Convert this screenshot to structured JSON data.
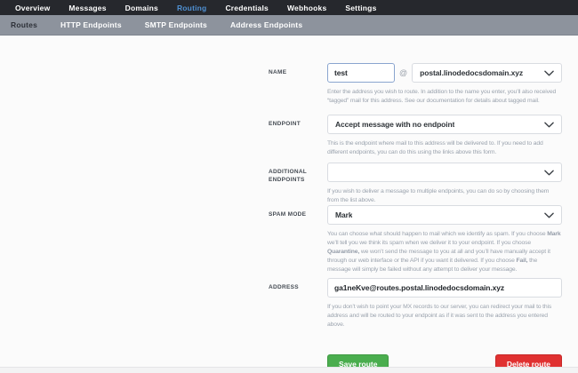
{
  "nav": {
    "items": [
      {
        "label": "Overview",
        "active": false
      },
      {
        "label": "Messages",
        "active": false
      },
      {
        "label": "Domains",
        "active": false
      },
      {
        "label": "Routing",
        "active": true
      },
      {
        "label": "Credentials",
        "active": false
      },
      {
        "label": "Webhooks",
        "active": false
      },
      {
        "label": "Settings",
        "active": false
      }
    ]
  },
  "subnav": {
    "items": [
      {
        "label": "Routes",
        "active": true
      },
      {
        "label": "HTTP Endpoints",
        "active": false
      },
      {
        "label": "SMTP Endpoints",
        "active": false
      },
      {
        "label": "Address Endpoints",
        "active": false
      }
    ]
  },
  "form": {
    "name": {
      "label": "NAME",
      "value": "test",
      "at_symbol": "@",
      "domain": "postal.linodedocsdomain.xyz",
      "help": "Enter the address you wish to route. In addition to the name you enter, you’ll also received “tagged” mail for this address. See our documentation for details about tagged mail."
    },
    "endpoint": {
      "label": "ENDPOINT",
      "value": "Accept message with no endpoint",
      "help": "This is the endpoint where mail to this address will be delivered to. If you need to add different endpoints, you can do this using the links above this form."
    },
    "additional_endpoints": {
      "label": "ADDITIONAL ENDPOINTS",
      "value": "",
      "help": "If you wish to deliver a message to multiple endpoints, you can do so by choosing them from the list above."
    },
    "spam_mode": {
      "label": "SPAM MODE",
      "value": "Mark",
      "help_segments": [
        "You can choose what should happen to mail which we identify as spam. If you choose ",
        "Mark",
        " we’ll tell you we think its spam when we deliver it to your endpoint. If you choose ",
        "Quarantine,",
        " we won’t send the message to you at all and you’ll have manually accept it through our web interface or the API if you want it delivered. If you choose ",
        "Fail,",
        " the message will simply be failed without any attempt to deliver your message."
      ]
    },
    "address": {
      "label": "ADDRESS",
      "value": "ga1neKve@routes.postal.linodedocsdomain.xyz",
      "help": "If you don’t wish to point your MX records to our server, you can redirect your mail to this address and will be routed to your endpoint as if it was sent to the address you entered above."
    },
    "buttons": {
      "save": "Save route",
      "delete": "Delete route"
    }
  },
  "colors": {
    "nav_bg": "#26282d",
    "nav_active_blue": "#4f90d2",
    "subnav_bg": "#8d939d",
    "subnav_active": "#2e3138",
    "save_green": "#4aad4e",
    "delete_red": "#e03131",
    "focus_border": "#8aa5cf"
  }
}
